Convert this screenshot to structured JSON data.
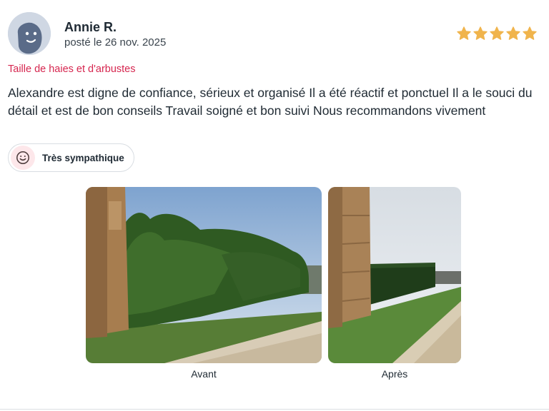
{
  "review": {
    "author": "Annie R.",
    "date": "posté le 26 nov. 2025",
    "rating": 5,
    "rating_max": 5,
    "category": "Taille de haies et d'arbustes",
    "text": "Alexandre est digne de confiance, sérieux et organisé Il a été réactif et ponctuel Il a le souci du détail et est de bon conseils Travail soigné et bon suivi Nous recommandons vivement",
    "tag": "Très sympathique",
    "photos": [
      {
        "caption": "Avant"
      },
      {
        "caption": "Après"
      }
    ]
  },
  "colors": {
    "category": "#d6264f",
    "star": "#f0b44c",
    "tag_bg": "#fde7ea"
  },
  "icons": {
    "avatar": "user-avatar-icon",
    "star": "star-icon",
    "tag": "smiley-icon"
  }
}
